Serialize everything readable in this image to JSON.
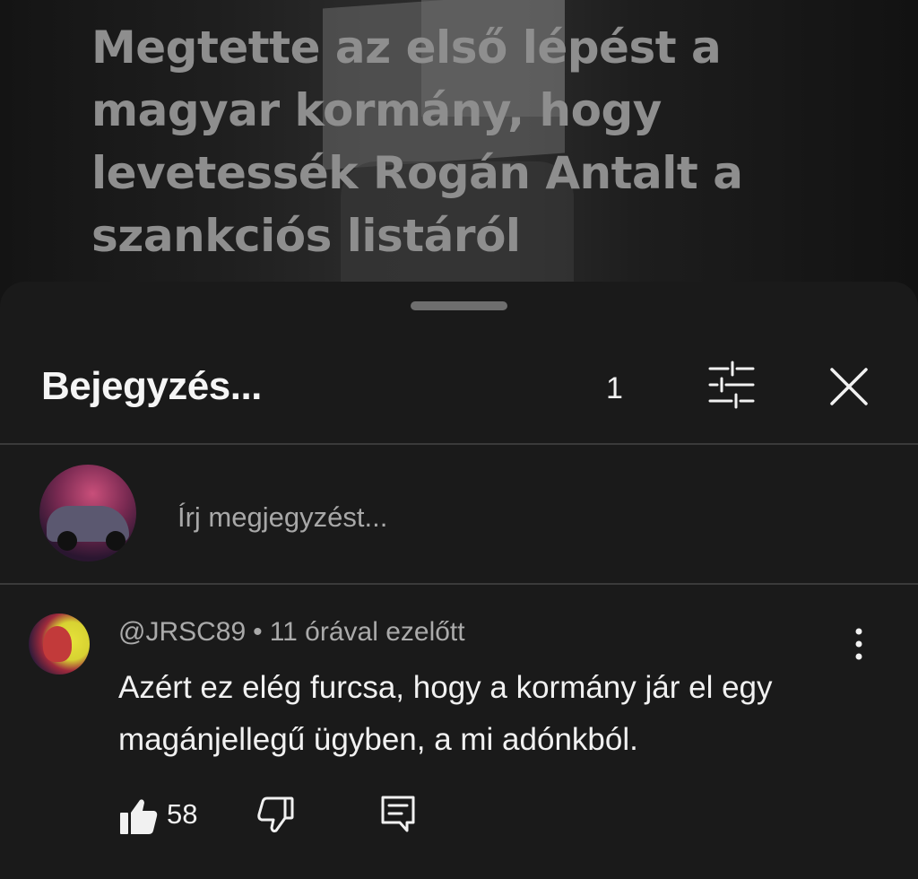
{
  "post": {
    "title": "Megtette az első lépést a magyar kormány, hogy levetessék Rogán Antalt a szankciós listáról"
  },
  "sheet": {
    "title": "Bejegyzés...",
    "count": "1",
    "filter_icon": "sliders-icon",
    "close_icon": "close-icon"
  },
  "composer": {
    "placeholder": "Írj megjegyzést..."
  },
  "comments": [
    {
      "author": "@JRSC89",
      "separator": "•",
      "time": "11 órával ezelőtt",
      "text": "Azért ez elég furcsa, hogy a kormány jár el egy magánjellegű ügyben, a mi adónkból.",
      "likes": "58",
      "icons": [
        "thumbs-up-icon",
        "thumbs-down-icon",
        "reply-icon",
        "more-vertical-icon"
      ]
    }
  ],
  "colors": {
    "sheet_bg": "#1a1a1a",
    "page_bg": "#0f0f0f",
    "text": "#f1f1f1",
    "meta": "#aaaaaa"
  }
}
